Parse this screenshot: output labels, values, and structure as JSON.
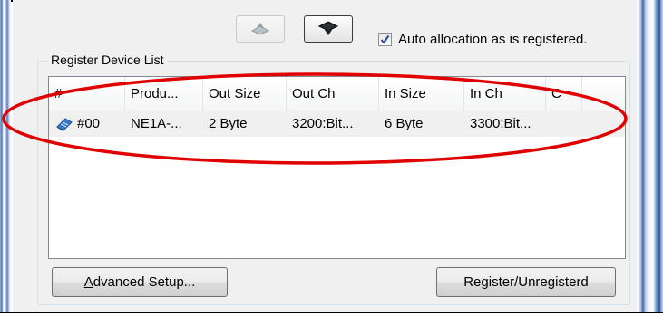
{
  "toolbar": {
    "collapse_icon": "collapse-icon",
    "expand_icon": "expand-icon",
    "auto_allocation": {
      "label": "Auto allocation as is registered.",
      "checked": true
    }
  },
  "group": {
    "title": "Register Device List"
  },
  "list": {
    "columns": [
      "#",
      "Produ...",
      "Out Size",
      "Out Ch",
      "In Size",
      "In Ch",
      "C"
    ],
    "rows": [
      {
        "icon": "device-icon",
        "cells": [
          "#00",
          "NE1A-...",
          "2 Byte",
          "3200:Bit...",
          "6 Byte",
          "3300:Bit..."
        ]
      }
    ]
  },
  "buttons": {
    "advanced_setup": {
      "prefix": "A",
      "rest": "dvanced Setup..."
    },
    "register": "Register/Unregisterd"
  },
  "colors": {
    "highlight": "#e00000",
    "panel": "#f0f0f0",
    "row_bg": "#f0f0f0"
  }
}
